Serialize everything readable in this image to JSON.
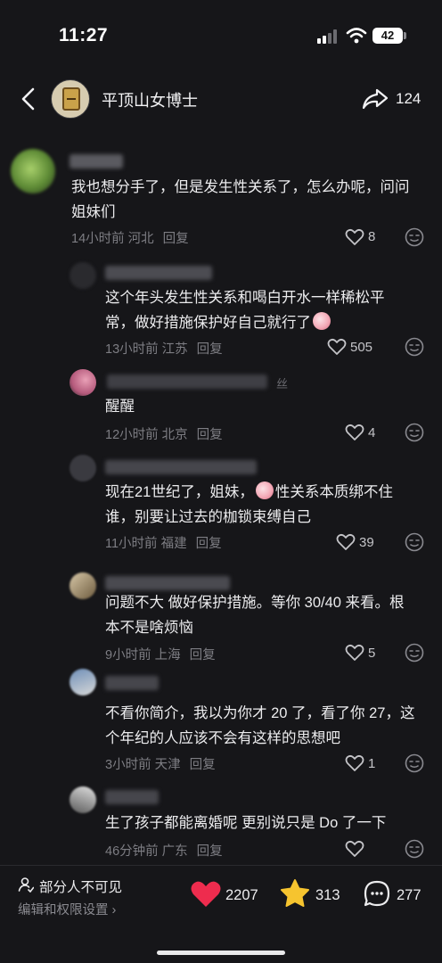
{
  "status": {
    "time": "11:27",
    "battery": "42"
  },
  "nav": {
    "title": "平顶山女博士",
    "share_count": "124"
  },
  "comments": [
    {
      "text_lines": [
        "我也想分手了，但是发生性关系了，怎么办呢，问问",
        "姐妹们"
      ],
      "time": "14小时前",
      "location": "河北",
      "reply": "回复",
      "likes": "8"
    },
    {
      "text_lines": [
        "这个年头发生性关系和喝白开水一样稀松平",
        "常，做好措施保护好自己就行了"
      ],
      "time": "13小时前",
      "location": "江苏",
      "reply": "回复",
      "likes": "505"
    },
    {
      "name_fragment": "丝",
      "text_lines": [
        "醒醒"
      ],
      "time": "12小时前",
      "location": "北京",
      "reply": "回复",
      "likes": "4"
    },
    {
      "text_lines": [
        "现在21世纪了，姐妹，",
        "性关系本质绑不住",
        "谁，别要让过去的枷锁束缚自己"
      ],
      "time": "11小时前",
      "location": "福建",
      "reply": "回复",
      "likes": "39"
    },
    {
      "text_lines": [
        "问题不大 做好保护措施。等你 30/40 来看。根",
        "本不是啥烦恼"
      ],
      "time": "9小时前",
      "location": "上海",
      "reply": "回复",
      "likes": "5"
    },
    {
      "text_lines": [
        "不看你简介，我以为你才 20 了，看了你 27，这",
        "个年纪的人应该不会有这样的思想吧"
      ],
      "time": "3小时前",
      "location": "天津",
      "reply": "回复",
      "likes": "1"
    },
    {
      "text_lines": [
        "生了孩子都能离婚呢 更别说只是 Do 了一下"
      ],
      "time": "46分钟前",
      "location": "广东",
      "reply": "回复",
      "likes": ""
    }
  ],
  "bottom": {
    "visibility_label": "部分人不可见",
    "edit_label": "编辑和权限设置 ›",
    "like_count": "2207",
    "favorite_count": "313",
    "comment_count": "277"
  },
  "colors": {
    "like_red": "#ee2c4e",
    "star_gold": "#f6c42f",
    "background": "#161619"
  }
}
